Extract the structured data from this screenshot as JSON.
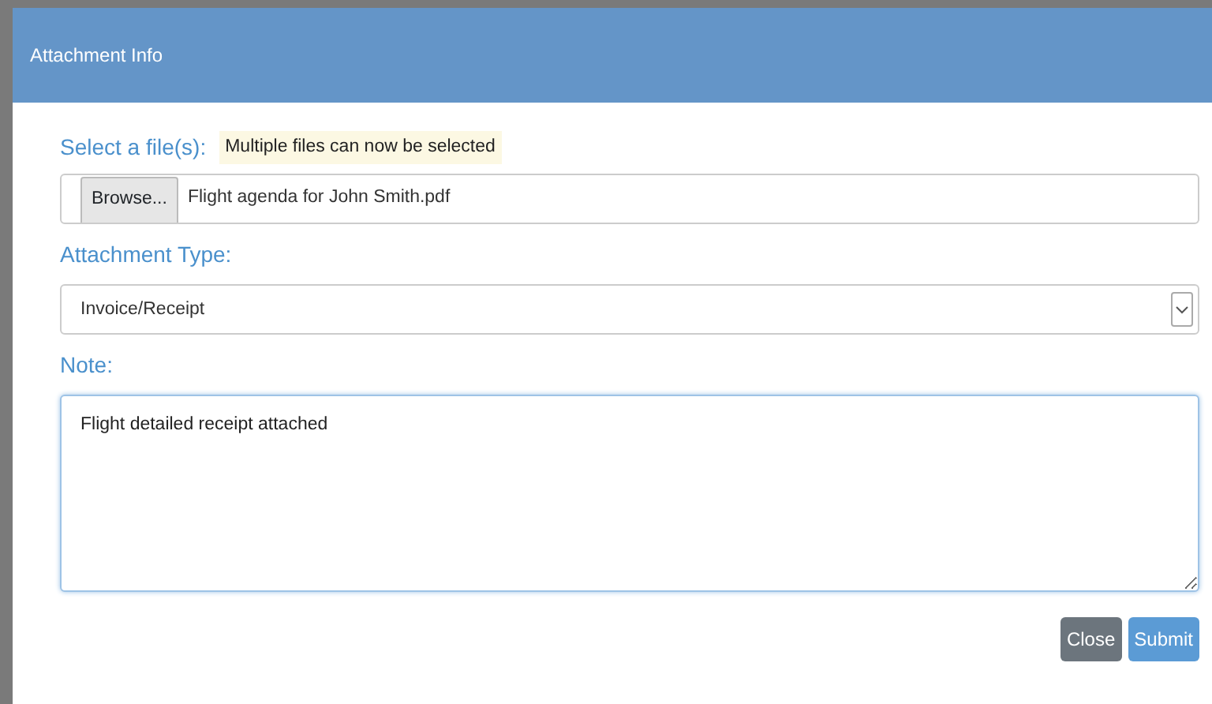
{
  "dialog": {
    "title": "Attachment Info"
  },
  "file_field": {
    "label": "Select a file(s):",
    "hint": "Multiple files can now be selected",
    "button": "Browse...",
    "value": "Flight agenda for John Smith.pdf"
  },
  "type_field": {
    "label": "Attachment Type:",
    "value": "Invoice/Receipt"
  },
  "note_field": {
    "label": "Note:",
    "value": "Flight detailed receipt attached",
    "focused": true
  },
  "buttons": [
    {
      "label": "Close",
      "kind": "secondary"
    },
    {
      "label": "Submit",
      "kind": "primary"
    }
  ]
}
